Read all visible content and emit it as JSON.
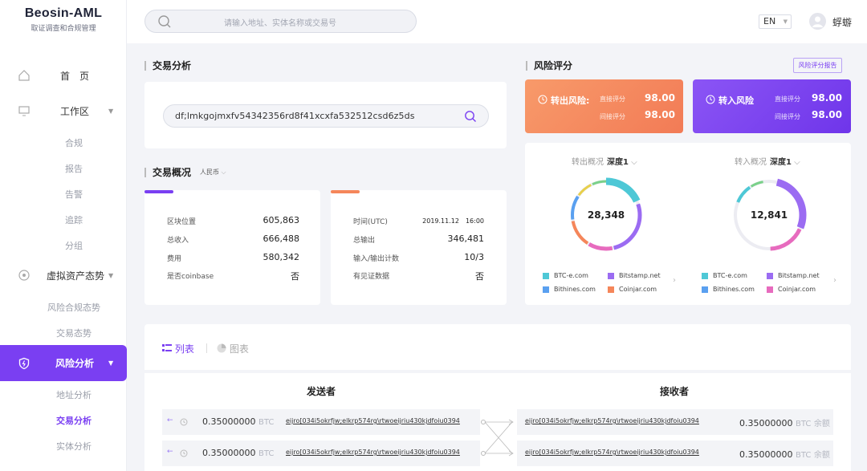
{
  "app": {
    "title": "Beosin-AML",
    "subtitle": "取证调查和合规管理"
  },
  "sidebar": {
    "home": "首　页",
    "workspace": "工作区",
    "workspace_items": [
      "合规",
      "报告",
      "告警",
      "追踪",
      "分组"
    ],
    "virtual": "虚拟资产态势",
    "virtual_items": [
      "风险合规态势",
      "交易态势"
    ],
    "risk": "风险分析",
    "risk_items": [
      "地址分析",
      "交易分析",
      "实体分析"
    ]
  },
  "header": {
    "search_placeholder": "请输入地址、实体名称或交易号",
    "lang": "EN",
    "user": "蜉蝣"
  },
  "tx": {
    "section_title": "交易分析",
    "hash": "df;lmkgojmxfv54342356rd8f41xcxfa532512csd6z5ds",
    "overview_title": "交易概况",
    "currency": "人民币",
    "left": [
      {
        "k": "区块位置",
        "v": "605,863"
      },
      {
        "k": "总收入",
        "v": "666,488"
      },
      {
        "k": "费用",
        "v": "580,342"
      },
      {
        "k": "是否coinbase",
        "v": "否"
      }
    ],
    "right": [
      {
        "k": "时间(UTC)",
        "v": "2019.11.12　16:00"
      },
      {
        "k": "总输出",
        "v": "346,481"
      },
      {
        "k": "输入/输出计数",
        "v": "10/3"
      },
      {
        "k": "有见证数据",
        "v": "否"
      }
    ],
    "left_accent": "#7a3ff2",
    "right_accent": "#f5865a"
  },
  "risk": {
    "section_title": "风险评分",
    "report": "风险评分报告",
    "out": {
      "name": "转出风险:",
      "direct_label": "直接评分",
      "direct": "98.00",
      "indirect_label": "间接评分",
      "indirect": "98.00",
      "color": "#f5865a"
    },
    "in": {
      "name": "转入风险",
      "direct_label": "直接评分",
      "direct": "98.00",
      "indirect_label": "间接评分",
      "indirect": "98.00",
      "color": "#7a3ff2"
    }
  },
  "charts": {
    "out": {
      "title": "转出概况",
      "depth": "深度1",
      "total": "28,348"
    },
    "in": {
      "title": "转入概况",
      "depth": "深度1",
      "total": "12,841"
    },
    "legend": [
      {
        "name": "BTC-e.com",
        "color": "#4ec8d6"
      },
      {
        "name": "Bitstamp.net",
        "color": "#9b6cf2"
      },
      {
        "name": "Bithines.com",
        "color": "#5aa0f0"
      },
      {
        "name": "Coinjar.com",
        "color": "#f5865a"
      }
    ],
    "legend_in": [
      {
        "name": "BTC-e.com",
        "color": "#4ec8d6"
      },
      {
        "name": "Bitstamp.net",
        "color": "#9b6cf2"
      },
      {
        "name": "Bithines.com",
        "color": "#5aa0f0"
      },
      {
        "name": "Coinjar.com",
        "color": "#e76bbe"
      }
    ]
  },
  "list": {
    "tab_list": "列表",
    "tab_chart": "图表",
    "sender": "发送者",
    "receiver": "接收者",
    "rows": [
      {
        "amount": "0.35000000",
        "unit": "BTC",
        "from": "eijro[034i5okrfjw;elkrp574rg\\rtwoeijriu430kjdfoiu0394",
        "to": "eijro[034i5okrfjw;elkrp574rg\\rtwoeijriu430kjdfoiu0394",
        "to_amount": "0.35000000",
        "to_unit": "BTC",
        "balance": "余额"
      },
      {
        "amount": "0.35000000",
        "unit": "BTC",
        "from": "eijro[034i5okrfjw;elkrp574rg\\rtwoeijriu430kjdfoiu0394",
        "to": "eijro[034i5okrfjw;elkrp574rg\\rtwoeijriu430kjdfoiu0394",
        "to_amount": "0.35000000",
        "to_unit": "BTC",
        "balance": "余额"
      }
    ]
  }
}
